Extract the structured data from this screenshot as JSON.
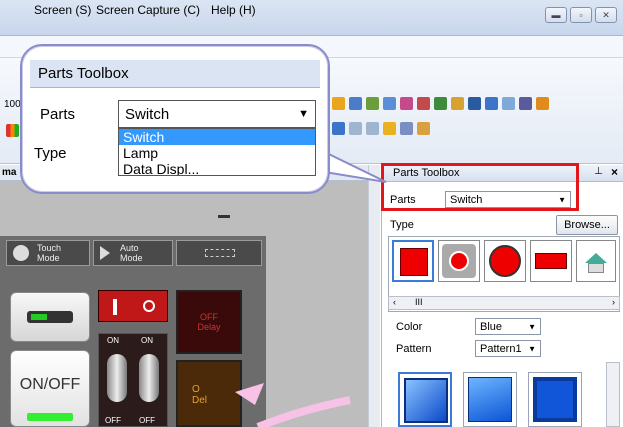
{
  "menu": [
    "Screen (S)",
    "Screen Capture (C)",
    "Help (H)"
  ],
  "toolbar": {
    "zoom_partial": "100"
  },
  "canvas": {
    "tab_partial": "ma",
    "mode_buttons": [
      {
        "label": "Touch\nMode",
        "icon": "hand-icon"
      },
      {
        "label": "Auto\nMode",
        "icon": "play-icon"
      },
      {
        "label": "",
        "icon": "grid-icon"
      }
    ],
    "switch_label": "ON/OFF",
    "toggle_labels": [
      "ON",
      "ON",
      "OFF",
      "OFF"
    ],
    "off_delay": "OFF\nDelay",
    "off_delay_partial": "O\nDel"
  },
  "pane": {
    "title": "Parts Toolbox",
    "parts_label": "Parts",
    "parts_value": "Switch",
    "type_label": "Type",
    "browse_label": "Browse...",
    "color_label": "Color",
    "color_value": "Blue",
    "pattern_label": "Pattern",
    "pattern_value": "Pattern1",
    "scroll_thumb": "III"
  },
  "callout": {
    "title": "Parts Toolbox",
    "parts_label": "Parts",
    "parts_value": "Switch",
    "type_label": "Type",
    "dropdown_options": [
      "Switch",
      "Lamp",
      "Data Displ..."
    ],
    "selected_option": "Switch"
  },
  "colors": {
    "highlight": "#e4141b",
    "selection": "#3399ff",
    "callout_border": "#8a8cc9"
  }
}
